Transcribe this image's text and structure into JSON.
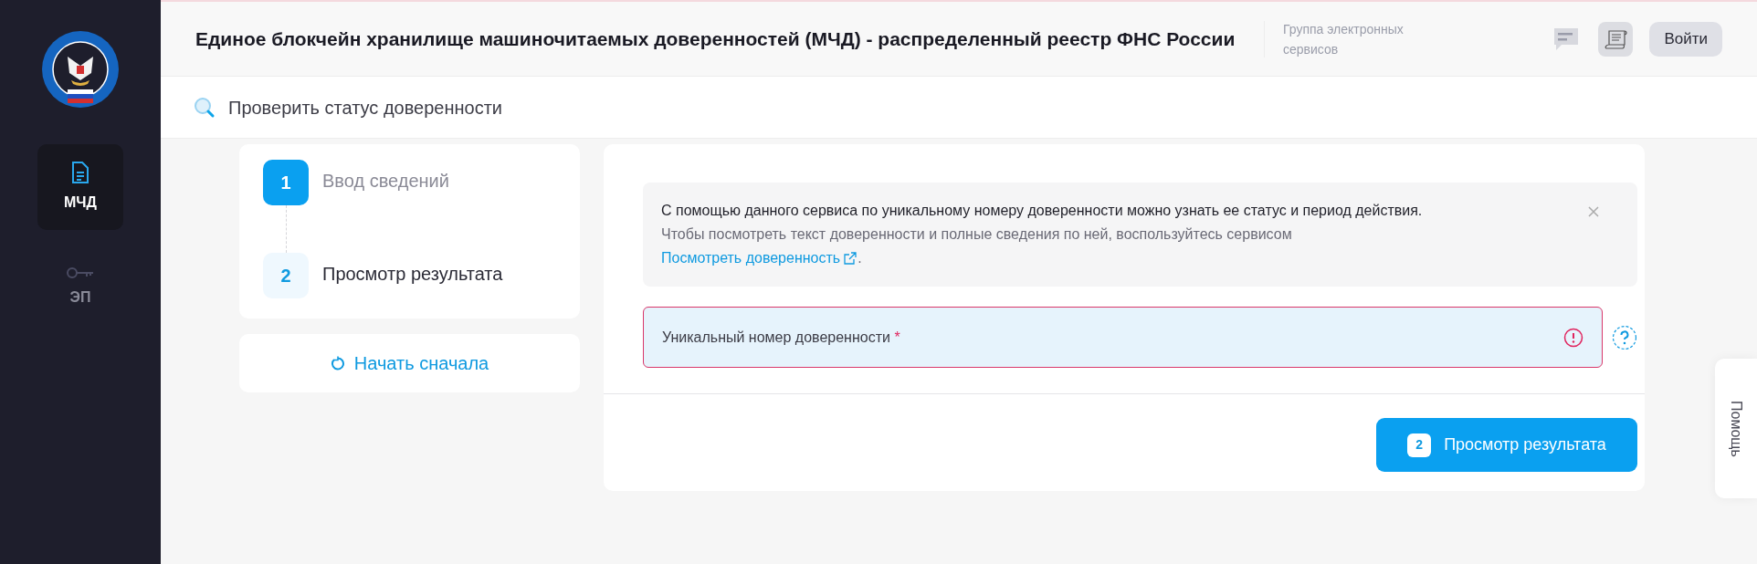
{
  "header": {
    "title": "Единое блокчейн хранилище машиночитаемых доверенностей (МЧД) - распределенный реестр ФНС России",
    "group": "Группа электронных сервисов",
    "login": "Войти"
  },
  "sidebar": {
    "items": [
      {
        "label": "МЧД",
        "kind": "document",
        "selected": true
      },
      {
        "label": "ЭП",
        "kind": "key",
        "selected": false
      }
    ]
  },
  "subheader": {
    "title": "Проверить статус доверенности"
  },
  "steps": [
    {
      "number": "1",
      "label": "Ввод сведений",
      "selected": true
    },
    {
      "number": "2",
      "label": "Просмотр результата",
      "selected": false
    }
  ],
  "restart": "Начать сначала",
  "info": {
    "text": "С помощью данного сервиса по уникальному номеру доверенности можно узнать ее статус и период действия.",
    "hint": "Чтобы посмотреть текст доверенности и полные сведения по ней, воспользуйтесь сервисом",
    "link": "Посмотреть доверенность",
    "after_link": "."
  },
  "field": {
    "placeholder": "Уникальный номер доверенности",
    "required_mark": "*",
    "error": true
  },
  "submit": {
    "number": "2",
    "label": "Просмотр результата"
  },
  "help_tab": "Помощь"
}
